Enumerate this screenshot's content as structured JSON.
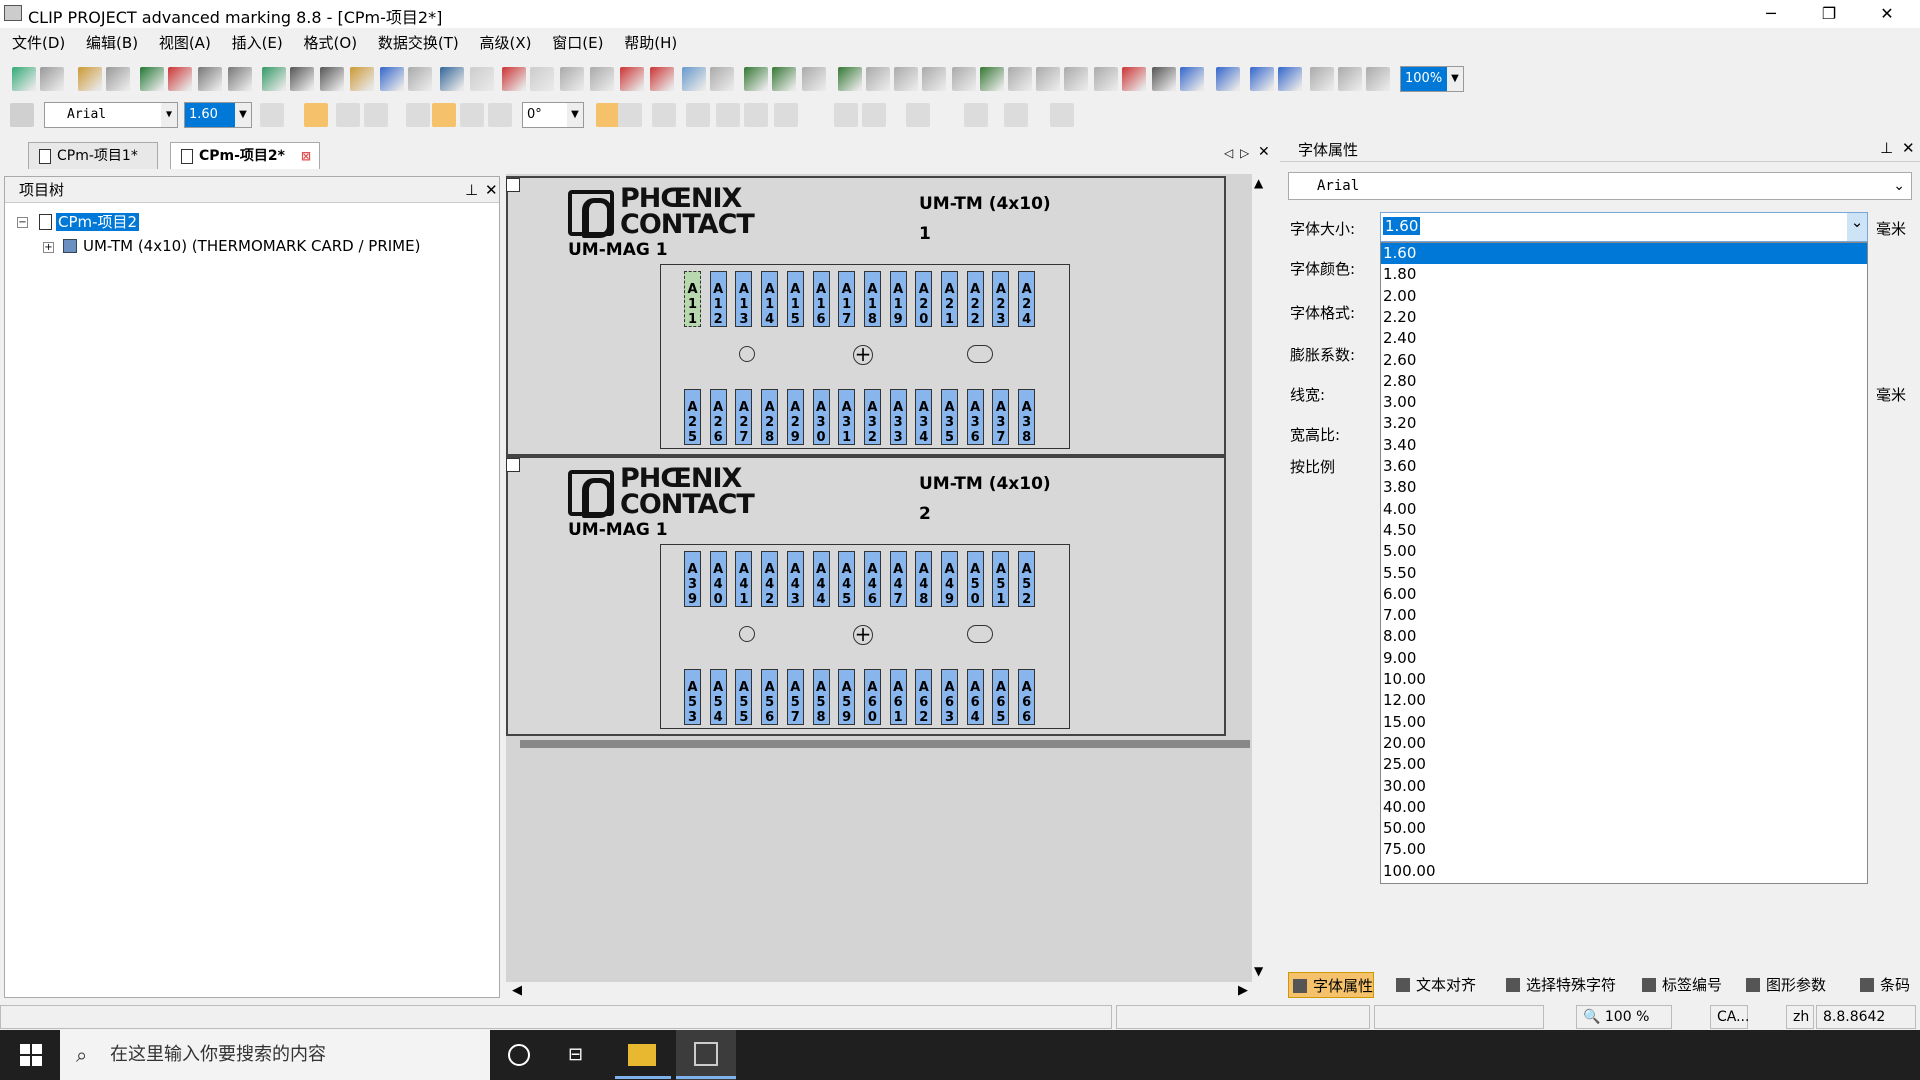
{
  "window": {
    "title": "CLIP PROJECT advanced marking 8.8 - [CPm-项目2*]",
    "min": "─",
    "max": "❐",
    "close": "✕"
  },
  "menu": [
    "文件(D)",
    "编辑(B)",
    "视图(A)",
    "插入(E)",
    "格式(O)",
    "数据交换(T)",
    "高级(X)",
    "窗口(E)",
    "帮助(H)"
  ],
  "toolbar": {
    "zoom": "100%",
    "font": "Arial",
    "font_size": "1.60",
    "rotation": "0°"
  },
  "doc_tabs": [
    "CPm-项目1*",
    "CPm-项目2*"
  ],
  "tree": {
    "title": "项目树",
    "root": "CPm-项目2",
    "child": "UM-TM (4x10) (THERMOMARK CARD / PRIME)"
  },
  "sheets": [
    {
      "brand1": "PHŒNIX",
      "brand2": "CONTACT",
      "mag": "UM-MAG 1",
      "model": "UM-TM (4x10)",
      "number": "1",
      "top": [
        "A11",
        "A12",
        "A13",
        "A14",
        "A15",
        "A16",
        "A17",
        "A18",
        "A19",
        "A20",
        "A21",
        "A22",
        "A23",
        "A24"
      ],
      "bottom": [
        "A25",
        "A26",
        "A27",
        "A28",
        "A29",
        "A30",
        "A31",
        "A32",
        "A33",
        "A34",
        "A35",
        "A36",
        "A37",
        "A38"
      ]
    },
    {
      "brand1": "PHŒNIX",
      "brand2": "CONTACT",
      "mag": "UM-MAG 1",
      "model": "UM-TM (4x10)",
      "number": "2",
      "top": [
        "A39",
        "A40",
        "A41",
        "A42",
        "A43",
        "A44",
        "A45",
        "A46",
        "A47",
        "A48",
        "A49",
        "A50",
        "A51",
        "A52"
      ],
      "bottom": [
        "A53",
        "A54",
        "A55",
        "A56",
        "A57",
        "A58",
        "A59",
        "A60",
        "A61",
        "A62",
        "A63",
        "A64",
        "A65",
        "A66"
      ]
    }
  ],
  "props": {
    "title": "字体属性",
    "font": "Arial",
    "size_label": "字体大小:",
    "color_label": "字体颜色:",
    "format_label": "字体格式:",
    "expand_label": "膨胀系数:",
    "linewidth_label": "线宽:",
    "ratio_label": "宽高比:",
    "scale_label": "按比例",
    "unit": "毫米",
    "unit2": "毫米",
    "size_value": "1.60",
    "sizes": [
      "1.60",
      "1.80",
      "2.00",
      "2.20",
      "2.40",
      "2.60",
      "2.80",
      "3.00",
      "3.20",
      "3.40",
      "3.60",
      "3.80",
      "4.00",
      "4.50",
      "5.00",
      "5.50",
      "6.00",
      "7.00",
      "8.00",
      "9.00",
      "10.00",
      "12.00",
      "15.00",
      "20.00",
      "25.00",
      "30.00",
      "40.00",
      "50.00",
      "75.00",
      "100.00"
    ]
  },
  "prop_tabs": [
    "字体属性",
    "文本对齐",
    "选择特殊字符",
    "标签编号",
    "图形参数",
    "条码"
  ],
  "status": {
    "zoom": "100 %",
    "caps": "CA...",
    "lang": "zh",
    "version": "8.8.8642"
  },
  "taskbar": {
    "search": "在这里输入你要搜索的内容"
  },
  "colors": {
    "cell": "#87b5ec",
    "accent": "#0078d7"
  }
}
